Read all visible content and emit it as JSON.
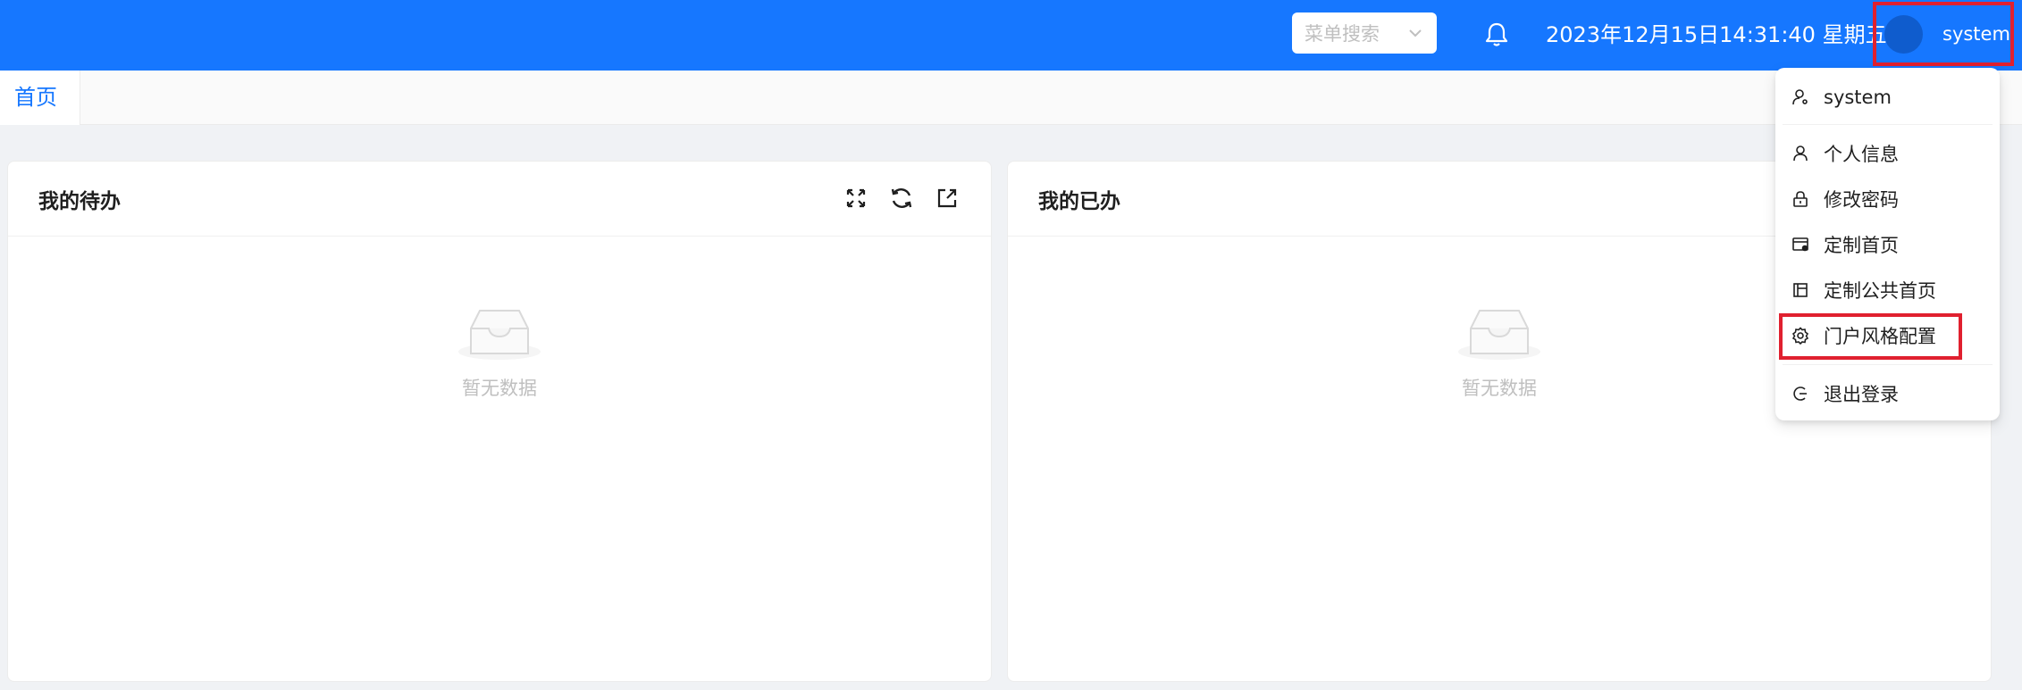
{
  "header": {
    "menu_search_placeholder": "菜单搜索",
    "datetime": "2023年12月15日14:31:40 星期五",
    "username": "system",
    "bg_color": "#1677ff"
  },
  "tabs": [
    {
      "label": "首页",
      "active": true
    }
  ],
  "cards": [
    {
      "title": "我的待办",
      "empty_text": "暂无数据",
      "tools": [
        "fullscreen-icon",
        "refresh-icon",
        "external-link-icon"
      ]
    },
    {
      "title": "我的已办",
      "empty_text": "暂无数据"
    }
  ],
  "user_menu": {
    "header_user": "system",
    "items": [
      {
        "label": "个人信息",
        "icon": "user-icon"
      },
      {
        "label": "修改密码",
        "icon": "lock-icon"
      },
      {
        "label": "定制首页",
        "icon": "layout-settings-icon"
      },
      {
        "label": "定制公共首页",
        "icon": "layout-icon"
      },
      {
        "label": "门户风格配置",
        "icon": "gear-icon",
        "highlighted": true
      }
    ],
    "logout_label": "退出登录"
  }
}
